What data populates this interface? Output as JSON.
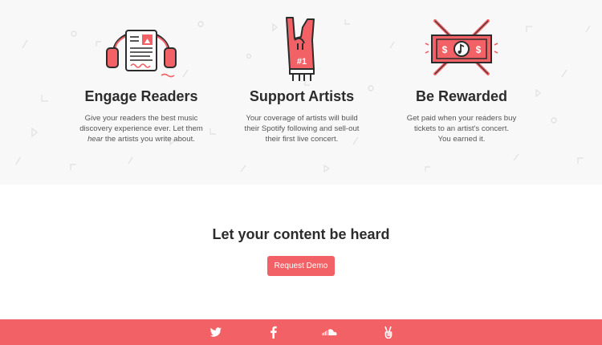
{
  "features": [
    {
      "icon": "headphones-reader-icon",
      "title": "Engage Readers",
      "line1": "Give your readers the best music",
      "line2": "discovery experience ever. Let them",
      "line3_em": "hear",
      "line3_rest": " the artists you write about."
    },
    {
      "icon": "foam-finger-icon",
      "title": "Support Artists",
      "line1": "Your coverage of artists will build",
      "line2": "their Spotify following and sell-out",
      "line3": "their first live concert.",
      "badge": "#1"
    },
    {
      "icon": "cash-drumsticks-icon",
      "title": "Be Rewarded",
      "line1": "Get paid when your readers buy",
      "line2": "tickets to an artist's concert.",
      "line3": "You earned it.",
      "bill_symbol": "$"
    }
  ],
  "cta": {
    "heading": "Let your content be heard",
    "button_label": "Request Demo"
  },
  "footer": {
    "social": [
      "twitter-icon",
      "facebook-icon",
      "soundcloud-icon",
      "peace-hand-icon"
    ]
  },
  "colors": {
    "accent": "#f26166",
    "section_bg": "#f8f8f8",
    "text": "#2c2c2c"
  }
}
